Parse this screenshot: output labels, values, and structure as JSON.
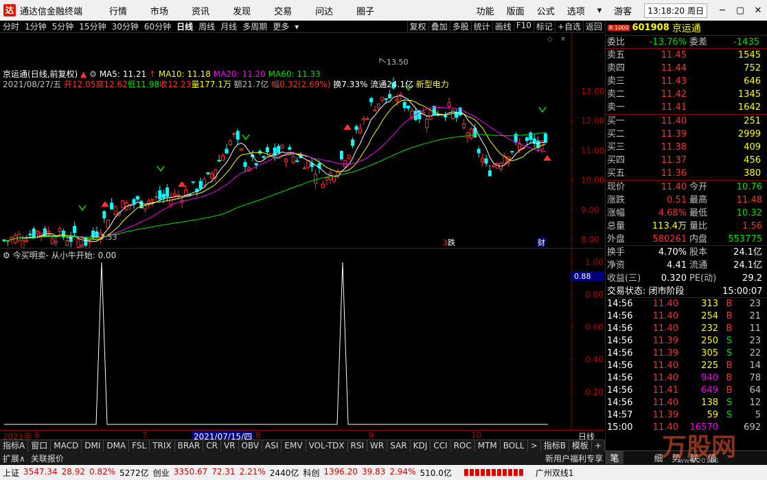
{
  "app": {
    "name": "通达信金融终端",
    "logo_char": "达"
  },
  "menu": [
    "行情",
    "市场",
    "资讯",
    "发现",
    "交易",
    "问达",
    "圈子"
  ],
  "title_right": [
    "功能",
    "版面",
    "公式",
    "选项",
    "游客"
  ],
  "clock": "13:18:20 周日",
  "toolbar": {
    "periods": [
      "分时",
      "1分钟",
      "5分钟",
      "15分钟",
      "30分钟",
      "60分钟",
      "日线",
      "周线",
      "月线",
      "多周期",
      "更多"
    ],
    "active": "日线",
    "actions": [
      "复权",
      "叠加",
      "多股",
      "统计",
      "画线",
      "F10",
      "标记",
      "+自选",
      "返回"
    ]
  },
  "kline": {
    "name": "京运通",
    "mode": "(日线,前复权)",
    "ma": [
      {
        "label": "MA5:",
        "value": "11.21",
        "color": "#ffffff"
      },
      {
        "label": "MA10:",
        "value": "11.18",
        "color": "#ffff00"
      },
      {
        "label": "MA20:",
        "value": "11.20",
        "color": "#ff00ff"
      },
      {
        "label": "MA60:",
        "value": "11.33",
        "color": "#00e600"
      }
    ],
    "date": "2021/08/27/五",
    "open": "开12.05",
    "high": "高12.62",
    "low": "低11.98",
    "close": "收12.23",
    "vol": "量177.1万",
    "amt": "额21.7亿",
    "chg": "幅0.32(2.69%)",
    "turn": "换7.33%",
    "float": "流通24.1亿",
    "tag": "新型电力"
  },
  "yaxis": [
    "13.00",
    "12.00",
    "11.00",
    "10.00",
    "9.00",
    "8.00"
  ],
  "high_label": "13.50",
  "low_label": "7.53",
  "markers": {
    "die": "跌",
    "die_prefix": "3",
    "cai": "财"
  },
  "indicator": {
    "title": "今买明卖- 从小牛开始: 0.00",
    "yaxis": [
      "1.00",
      "0.80",
      "0.60",
      "0.40",
      "0.20"
    ],
    "current": "0.88"
  },
  "xaxis": {
    "labels": [
      "2021年",
      "6",
      "7",
      "8",
      "9",
      "10"
    ],
    "cursor_date": "2021/07/15/四",
    "period": "日线"
  },
  "ind_tabs": [
    "指标A",
    "窗口",
    "MACD",
    "DMI",
    "DMA",
    "FSL",
    "TRIX",
    "BRAR",
    "CR",
    "VR",
    "OBV",
    "ASI",
    "EMV",
    "VOL-TDX",
    "RSI",
    "WR",
    "SAR",
    "KDJ",
    "CCI",
    "ROC",
    "MTM",
    "BOLL",
    ">",
    "指标B",
    "模板",
    "+",
    "-"
  ],
  "bottom2": [
    "扩展",
    "关联报价"
  ],
  "promo": "新用户福利专享",
  "panel": {
    "code": "601908",
    "name": "京运通",
    "code_tag": "R 1000",
    "weibi": {
      "label": "委比",
      "value": "-13.76%",
      "label2": "委差",
      "value2": "-1435"
    },
    "asks": [
      {
        "label": "卖五",
        "price": "11.45",
        "vol": "1545"
      },
      {
        "label": "卖四",
        "price": "11.44",
        "vol": "752"
      },
      {
        "label": "卖三",
        "price": "11.43",
        "vol": "646"
      },
      {
        "label": "卖二",
        "price": "11.42",
        "vol": "1345"
      },
      {
        "label": "卖一",
        "price": "11.41",
        "vol": "1642"
      }
    ],
    "bids": [
      {
        "label": "买一",
        "price": "11.40",
        "vol": "251"
      },
      {
        "label": "买二",
        "price": "11.39",
        "vol": "2999"
      },
      {
        "label": "买三",
        "price": "11.38",
        "vol": "409"
      },
      {
        "label": "买四",
        "price": "11.37",
        "vol": "456"
      },
      {
        "label": "买五",
        "price": "11.36",
        "vol": "380"
      }
    ],
    "stats": [
      {
        "l1": "现价",
        "v1": "11.40",
        "c1": "#ff3232",
        "l2": "今开",
        "v2": "10.76",
        "c2": "#00e600"
      },
      {
        "l1": "涨跌",
        "v1": "0.51",
        "c1": "#ff3232",
        "l2": "最高",
        "v2": "11.48",
        "c2": "#ff3232"
      },
      {
        "l1": "涨幅",
        "v1": "4.68%",
        "c1": "#ff3232",
        "l2": "最低",
        "v2": "10.32",
        "c2": "#00e600"
      },
      {
        "l1": "总量",
        "v1": "113.4万",
        "c1": "#ffff00",
        "l2": "量比",
        "v2": "1.56",
        "c2": "#ff3232"
      },
      {
        "l1": "外盘",
        "v1": "580261",
        "c1": "#ff3232",
        "l2": "内盘",
        "v2": "553775",
        "c2": "#00e600"
      },
      {
        "l1": "换手",
        "v1": "4.70%",
        "c1": "#ffffff",
        "l2": "股本",
        "v2": "24.1亿",
        "c2": "#ffffff"
      },
      {
        "l1": "净资",
        "v1": "4.41",
        "c1": "#ffffff",
        "l2": "流通",
        "v2": "24.1亿",
        "c2": "#ffffff"
      },
      {
        "l1": "收益(三)",
        "v1": "0.320",
        "c1": "#ffffff",
        "l2": "PE(动)",
        "v2": "29.2",
        "c2": "#ffffff"
      }
    ],
    "trade_state": "交易状态: 闭市阶段",
    "trade_time": "15:00:07",
    "ticks": [
      {
        "t": "14:56",
        "p": "11.40",
        "v": "313",
        "vc": "#ffff00",
        "bs": "B",
        "n": "23"
      },
      {
        "t": "14:56",
        "p": "11.40",
        "v": "254",
        "vc": "#ffff00",
        "bs": "B",
        "n": "21"
      },
      {
        "t": "14:56",
        "p": "11.40",
        "v": "232",
        "vc": "#ffff00",
        "bs": "B",
        "n": "11"
      },
      {
        "t": "14:56",
        "p": "11.39",
        "v": "250",
        "vc": "#ffff00",
        "bs": "S",
        "n": "23"
      },
      {
        "t": "14:56",
        "p": "11.39",
        "v": "305",
        "vc": "#ffff00",
        "bs": "S",
        "n": "22"
      },
      {
        "t": "14:56",
        "p": "11.40",
        "v": "225",
        "vc": "#ffff00",
        "bs": "B",
        "n": "14"
      },
      {
        "t": "14:56",
        "p": "11.40",
        "v": "940",
        "vc": "#ff00ff",
        "bs": "B",
        "n": "78"
      },
      {
        "t": "14:56",
        "p": "11.41",
        "v": "649",
        "vc": "#ff00ff",
        "bs": "B",
        "n": "64"
      },
      {
        "t": "14:56",
        "p": "11.40",
        "v": "138",
        "vc": "#ffff00",
        "bs": "S",
        "n": "12"
      },
      {
        "t": "14:57",
        "p": "11.39",
        "v": "59",
        "vc": "#ffff00",
        "bs": "S",
        "n": "5"
      },
      {
        "t": "15:00",
        "p": "11.40",
        "v": "16570",
        "vc": "#ff00ff",
        "bs": "",
        "n": "692"
      }
    ],
    "bottom_tabs": [
      "笔",
      "细",
      "势",
      "联",
      "值"
    ]
  },
  "status": [
    {
      "t": "上证",
      "c": "#000"
    },
    {
      "t": "3547.34",
      "c": "#d00000"
    },
    {
      "t": "28.92",
      "c": "#d00000"
    },
    {
      "t": "0.82%",
      "c": "#d00000"
    },
    {
      "t": "5272亿",
      "c": "#000"
    },
    {
      "t": "创业",
      "c": "#000"
    },
    {
      "t": "3350.67",
      "c": "#d00000"
    },
    {
      "t": "72.31",
      "c": "#d00000"
    },
    {
      "t": "2.21%",
      "c": "#d00000"
    },
    {
      "t": "2440亿",
      "c": "#000"
    },
    {
      "t": "科创",
      "c": "#000"
    },
    {
      "t": "1396.20",
      "c": "#d00000"
    },
    {
      "t": "39.83",
      "c": "#d00000"
    },
    {
      "t": "2.94%",
      "c": "#d00000"
    },
    {
      "t": "510.0亿",
      "c": "#000"
    }
  ],
  "status_right": "广州双线1",
  "watermark": "万股网",
  "watermark_url": "www.20106"
}
